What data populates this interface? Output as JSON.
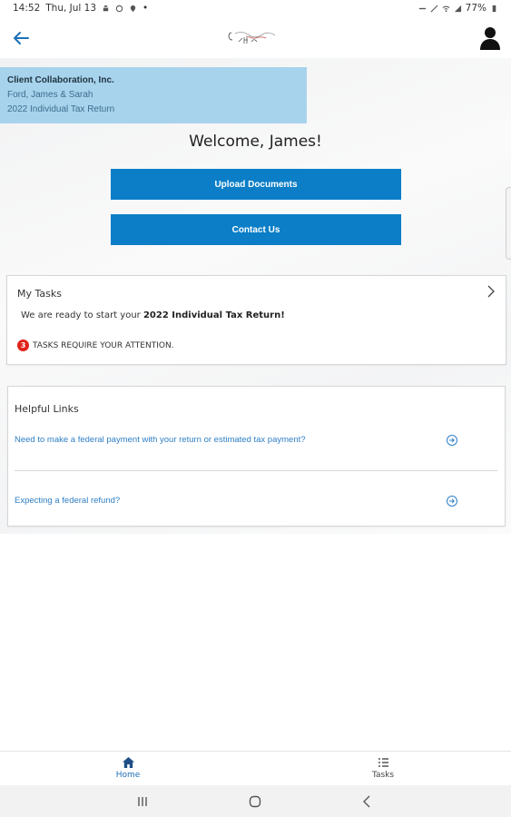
{
  "status_bar": {
    "time": "14:52",
    "date": "Thu, Jul 13",
    "battery": "77%"
  },
  "app_bar": {
    "logo_text": "Client Collaboration"
  },
  "client": {
    "firm_name": "Client Collaboration, Inc.",
    "client_name": "Ford, James & Sarah",
    "return_name": "2022 Individual Tax Return"
  },
  "welcome": "Welcome,  James!",
  "buttons": {
    "upload": "Upload Documents",
    "contact": "Contact Us"
  },
  "tasks": {
    "title": "My Tasks",
    "message_prefix": "We are ready to start your ",
    "message_bold": "2022 Individual Tax Return!",
    "count": "3",
    "attention": "TASKS REQUIRE YOUR ATTENTION."
  },
  "helpful_links": {
    "title": "Helpful Links",
    "items": [
      {
        "label": "Need to make a federal payment with your return or estimated tax payment?"
      },
      {
        "label": "Expecting a federal refund?"
      }
    ]
  },
  "bottom_nav": {
    "home": "Home",
    "tasks": "Tasks"
  },
  "colors": {
    "primary": "#0b7ec7",
    "client_card": "#a8d3ec",
    "link": "#2f7fc5",
    "badge": "#e0231b"
  }
}
